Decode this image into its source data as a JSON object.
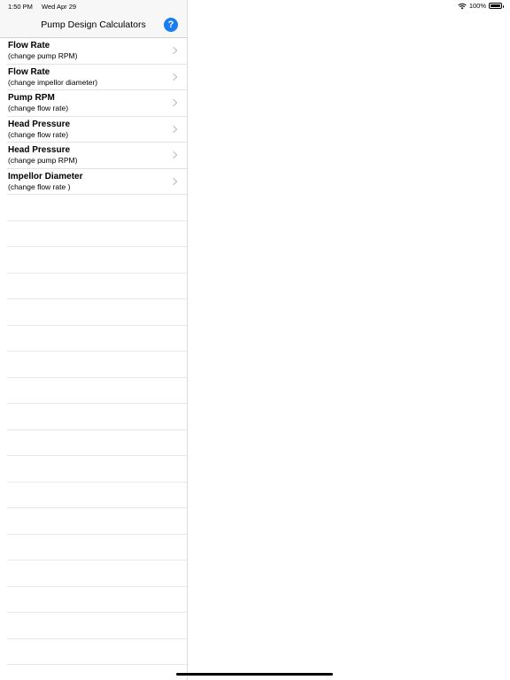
{
  "status_bar": {
    "time": "1:50 PM",
    "date": "Wed Apr 29",
    "battery_text": "100%",
    "battery_level": 1.0,
    "wifi_icon": "wifi-icon"
  },
  "nav": {
    "title": "Pump Design Calculators",
    "help_label": "?",
    "accent_color": "#1a7cf2"
  },
  "calculators": [
    {
      "title": "Flow Rate",
      "subtitle": "(change pump RPM)"
    },
    {
      "title": "Flow Rate",
      "subtitle": "(change impellor diameter)"
    },
    {
      "title": "Pump RPM",
      "subtitle": "(change flow rate)"
    },
    {
      "title": "Head Pressure",
      "subtitle": "(change flow rate)"
    },
    {
      "title": "Head Pressure",
      "subtitle": "(change pump RPM)"
    },
    {
      "title": "Impellor Diameter",
      "subtitle": "(change flow rate )"
    }
  ]
}
